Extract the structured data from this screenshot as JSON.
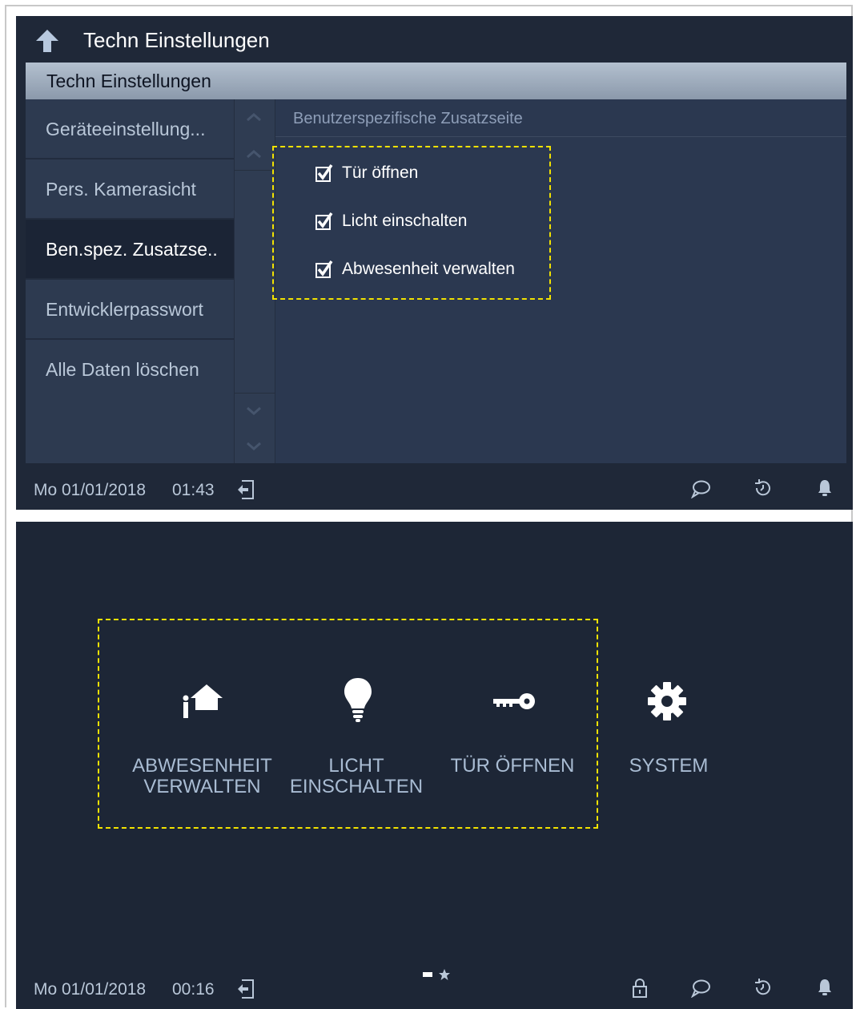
{
  "screen1": {
    "title": "Techn Einstellungen",
    "header": "Techn Einstellungen",
    "menu": [
      {
        "label": "Geräteeinstellung..."
      },
      {
        "label": "Pers. Kamerasicht"
      },
      {
        "label": "Ben.spez. Zusatzse.."
      },
      {
        "label": "Entwicklerpasswort"
      },
      {
        "label": "Alle Daten löschen"
      }
    ],
    "content_title": "Benutzerspezifische Zusatzseite",
    "checkboxes": [
      {
        "label": "Tür öffnen",
        "checked": true
      },
      {
        "label": "Licht einschalten",
        "checked": true
      },
      {
        "label": "Abwesenheit verwalten",
        "checked": true
      }
    ],
    "status": {
      "date": "Mo 01/01/2018",
      "time": "01:43"
    }
  },
  "screen2": {
    "apps": [
      {
        "line1": "ABWESENHEIT",
        "line2": "VERWALTEN",
        "icon": "away-home-icon"
      },
      {
        "line1": "LICHT",
        "line2": "EINSCHALTEN",
        "icon": "light-bulb-icon"
      },
      {
        "line1": "TÜR ÖFFNEN",
        "line2": "",
        "icon": "key-icon"
      },
      {
        "line1": "SYSTEM",
        "line2": "",
        "icon": "gear-icon"
      }
    ],
    "status": {
      "date": "Mo 01/01/2018",
      "time": "00:16"
    }
  },
  "colors": {
    "highlight_dash": "#f2e200",
    "background": "#1f2838",
    "menu_text": "#b9c7d8"
  }
}
